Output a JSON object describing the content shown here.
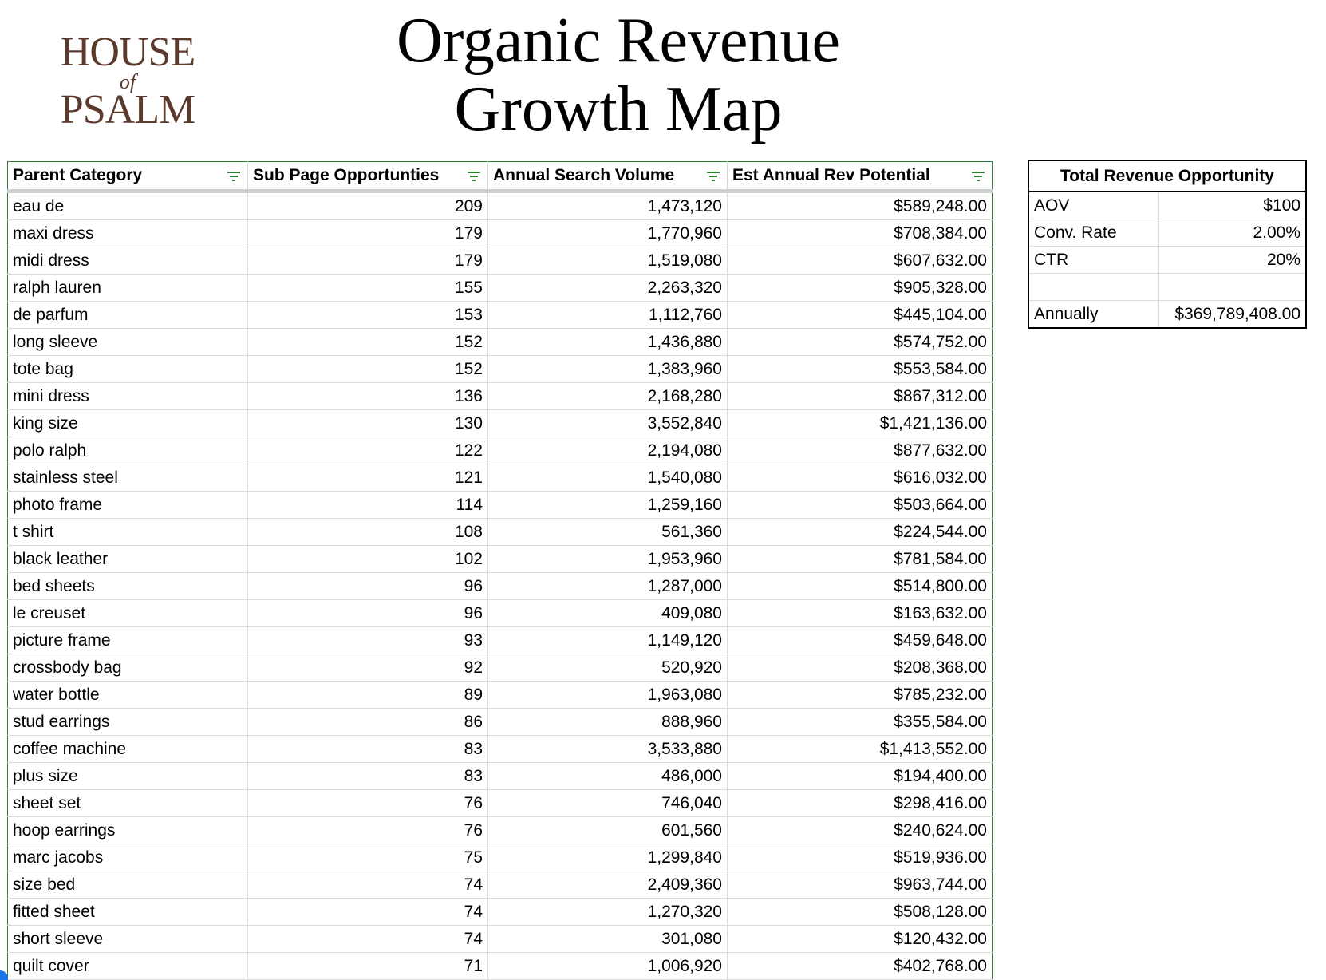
{
  "logo": {
    "line1": "HOUSE",
    "line2": "of",
    "line3": "PSALM"
  },
  "title": {
    "line1": "Organic Revenue",
    "line2": "Growth Map"
  },
  "table": {
    "headers": [
      "Parent Category",
      "Sub Page Opportunties",
      "Annual Search Volume",
      "Est Annual Rev Potential"
    ],
    "rows": [
      [
        "eau de",
        "209",
        "1,473,120",
        "$589,248.00"
      ],
      [
        "maxi dress",
        "179",
        "1,770,960",
        "$708,384.00"
      ],
      [
        "midi dress",
        "179",
        "1,519,080",
        "$607,632.00"
      ],
      [
        "ralph lauren",
        "155",
        "2,263,320",
        "$905,328.00"
      ],
      [
        "de parfum",
        "153",
        "1,112,760",
        "$445,104.00"
      ],
      [
        "long sleeve",
        "152",
        "1,436,880",
        "$574,752.00"
      ],
      [
        "tote bag",
        "152",
        "1,383,960",
        "$553,584.00"
      ],
      [
        "mini dress",
        "136",
        "2,168,280",
        "$867,312.00"
      ],
      [
        "king size",
        "130",
        "3,552,840",
        "$1,421,136.00"
      ],
      [
        "polo ralph",
        "122",
        "2,194,080",
        "$877,632.00"
      ],
      [
        "stainless steel",
        "121",
        "1,540,080",
        "$616,032.00"
      ],
      [
        "photo frame",
        "114",
        "1,259,160",
        "$503,664.00"
      ],
      [
        "t shirt",
        "108",
        "561,360",
        "$224,544.00"
      ],
      [
        "black leather",
        "102",
        "1,953,960",
        "$781,584.00"
      ],
      [
        "bed sheets",
        "96",
        "1,287,000",
        "$514,800.00"
      ],
      [
        "le creuset",
        "96",
        "409,080",
        "$163,632.00"
      ],
      [
        "picture frame",
        "93",
        "1,149,120",
        "$459,648.00"
      ],
      [
        "crossbody bag",
        "92",
        "520,920",
        "$208,368.00"
      ],
      [
        "water bottle",
        "89",
        "1,963,080",
        "$785,232.00"
      ],
      [
        "stud earrings",
        "86",
        "888,960",
        "$355,584.00"
      ],
      [
        "coffee machine",
        "83",
        "3,533,880",
        "$1,413,552.00"
      ],
      [
        "plus size",
        "83",
        "486,000",
        "$194,400.00"
      ],
      [
        "sheet set",
        "76",
        "746,040",
        "$298,416.00"
      ],
      [
        "hoop earrings",
        "76",
        "601,560",
        "$240,624.00"
      ],
      [
        "marc jacobs",
        "75",
        "1,299,840",
        "$519,936.00"
      ],
      [
        "size bed",
        "74",
        "2,409,360",
        "$963,744.00"
      ],
      [
        "fitted sheet",
        "74",
        "1,270,320",
        "$508,128.00"
      ],
      [
        "short sleeve",
        "74",
        "301,080",
        "$120,432.00"
      ],
      [
        "quilt cover",
        "71",
        "1,006,920",
        "$402,768.00"
      ]
    ]
  },
  "summary": {
    "title": "Total Revenue Opportunity",
    "rows": [
      [
        "AOV",
        "$100"
      ],
      [
        "Conv. Rate",
        "2.00%"
      ],
      [
        "CTR",
        "20%"
      ],
      [
        "",
        ""
      ],
      [
        "Annually",
        "$369,789,408.00"
      ]
    ]
  },
  "colors": {
    "logo": "#5b3a2e",
    "filter_icon": "#2e7d32",
    "table_border": "#2e7d32"
  },
  "icons": {
    "filter": "filter-icon"
  }
}
